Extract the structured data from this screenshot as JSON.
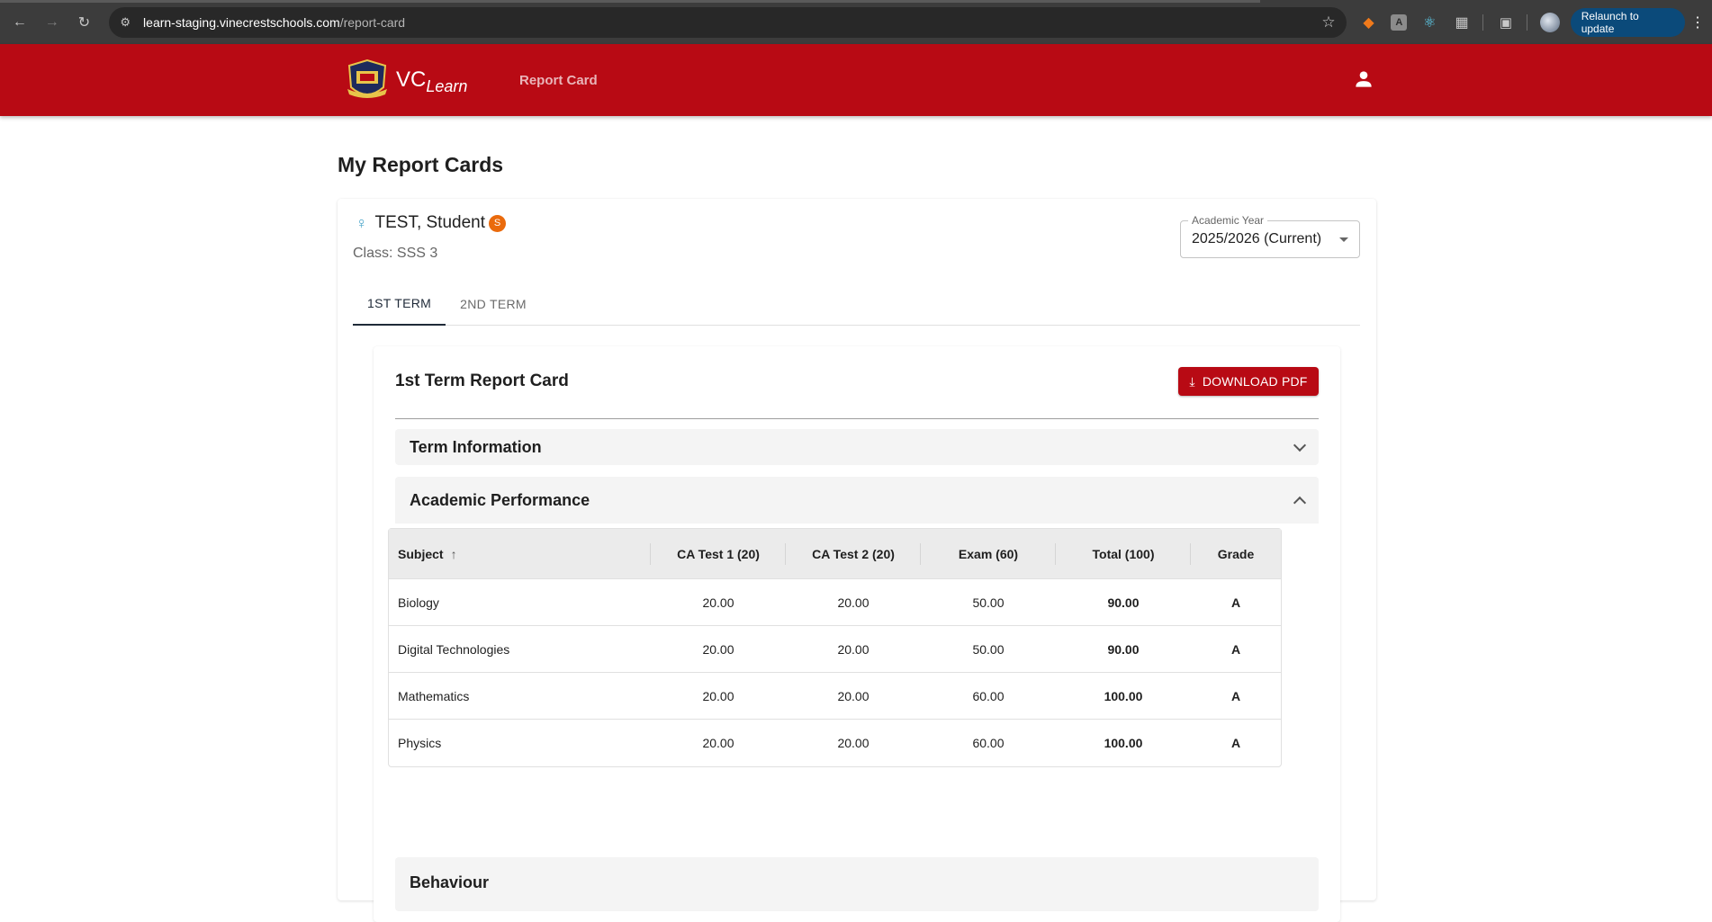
{
  "browser": {
    "url_host": "learn-staging.vinecrestschools.com",
    "url_path": "/report-card",
    "relaunch_label": "Relaunch to update"
  },
  "appbar": {
    "brand_main": "VC",
    "brand_sub": "Learn",
    "nav_report_card": "Report Card"
  },
  "page": {
    "title": "My Report Cards"
  },
  "student": {
    "name": "TEST, Student",
    "badge": "S",
    "class_line": "Class: SSS 3"
  },
  "academic_year": {
    "legend": "Academic Year",
    "value": "2025/2026 (Current)"
  },
  "tabs": [
    {
      "label": "1ST TERM",
      "active": true
    },
    {
      "label": "2ND TERM",
      "active": false
    }
  ],
  "report": {
    "title": "1st Term Report Card",
    "download_label": "DOWNLOAD PDF"
  },
  "sections": {
    "term_info": "Term Information",
    "academic_performance": "Academic Performance",
    "behaviour": "Behaviour"
  },
  "table": {
    "headers": [
      "Subject",
      "CA Test 1 (20)",
      "CA Test 2 (20)",
      "Exam (60)",
      "Total (100)",
      "Grade"
    ],
    "rows": [
      [
        "Biology",
        "20.00",
        "20.00",
        "50.00",
        "90.00",
        "A"
      ],
      [
        "Digital Technologies",
        "20.00",
        "20.00",
        "50.00",
        "90.00",
        "A"
      ],
      [
        "Mathematics",
        "20.00",
        "20.00",
        "60.00",
        "100.00",
        "A"
      ],
      [
        "Physics",
        "20.00",
        "20.00",
        "60.00",
        "100.00",
        "A"
      ]
    ]
  },
  "colors": {
    "brand_red": "#b80a14",
    "badge_orange": "#ea6a0c"
  }
}
